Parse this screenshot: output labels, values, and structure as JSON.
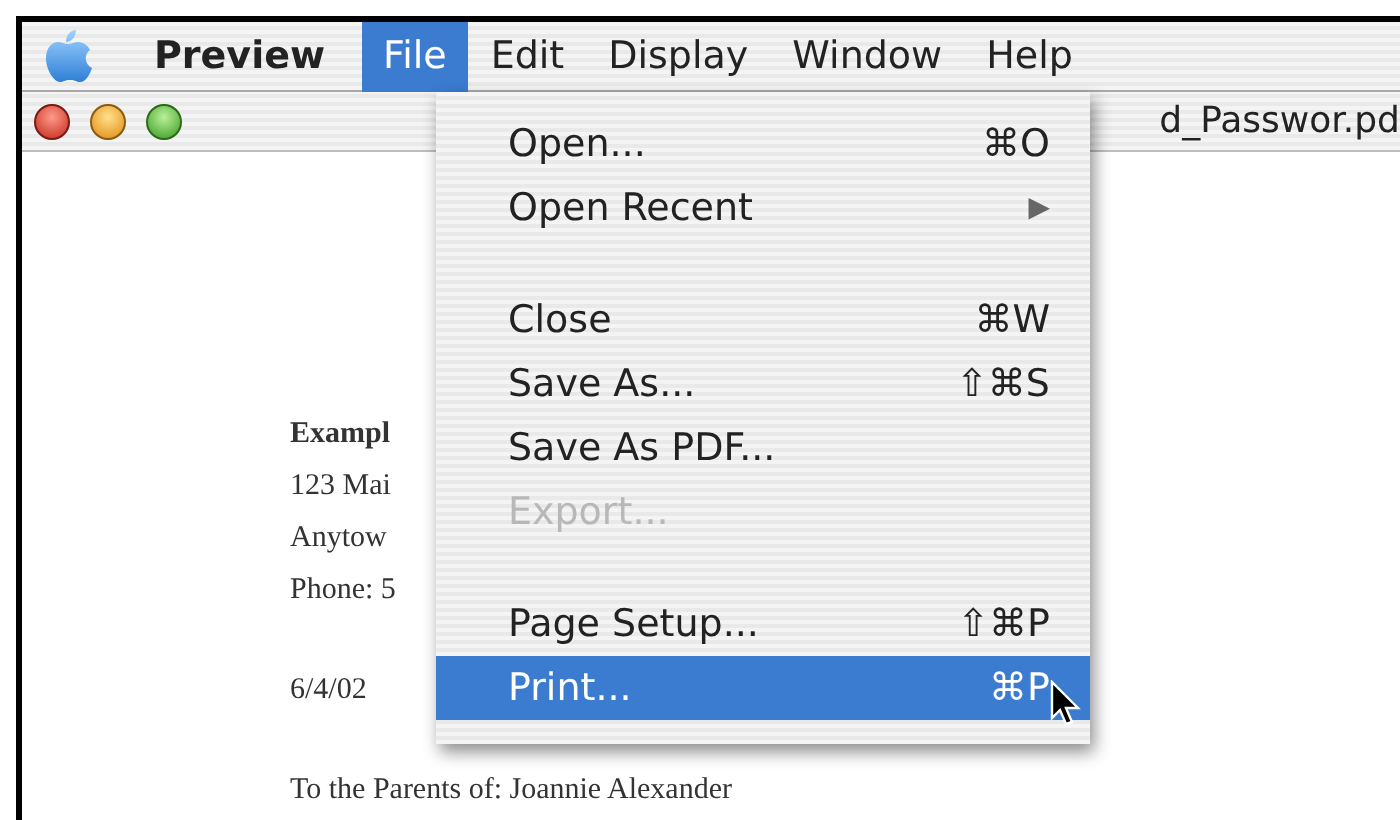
{
  "menu_bar": {
    "app": "Preview",
    "menus": [
      {
        "label": "File",
        "selected": true
      },
      {
        "label": "Edit",
        "selected": false
      },
      {
        "label": "Display",
        "selected": false
      },
      {
        "label": "Window",
        "selected": false
      },
      {
        "label": "Help",
        "selected": false
      }
    ]
  },
  "window": {
    "title": "d_Passwor.pd"
  },
  "document": {
    "blocks": [
      {
        "lines": [
          {
            "text": "Exampl",
            "bold": true
          },
          {
            "text": "123 Mai",
            "bold": false
          },
          {
            "text": "Anytow",
            "bold": false
          },
          {
            "text": "Phone: 5",
            "bold": false
          }
        ]
      },
      {
        "lines": [
          {
            "text": "6/4/02",
            "bold": false
          }
        ]
      },
      {
        "lines": [
          {
            "text": "To the Parents of: Joannie Alexander",
            "bold": false
          }
        ]
      }
    ]
  },
  "file_menu": {
    "items": [
      {
        "kind": "item",
        "label": "Open...",
        "shortcut": "⌘O",
        "disabled": false,
        "selected": false
      },
      {
        "kind": "item",
        "label": "Open Recent",
        "arrow": "▶",
        "disabled": false,
        "selected": false
      },
      {
        "kind": "separator"
      },
      {
        "kind": "item",
        "label": "Close",
        "shortcut": "⌘W",
        "disabled": false,
        "selected": false
      },
      {
        "kind": "item",
        "label": "Save As...",
        "shortcut": "⇧⌘S",
        "disabled": false,
        "selected": false
      },
      {
        "kind": "item",
        "label": "Save As PDF...",
        "disabled": false,
        "selected": false
      },
      {
        "kind": "item",
        "label": "Export...",
        "disabled": true,
        "selected": false
      },
      {
        "kind": "separator"
      },
      {
        "kind": "item",
        "label": "Page Setup...",
        "shortcut": "⇧⌘P",
        "disabled": false,
        "selected": false
      },
      {
        "kind": "item",
        "label": "Print...",
        "shortcut": "⌘P",
        "disabled": false,
        "selected": true
      }
    ]
  }
}
